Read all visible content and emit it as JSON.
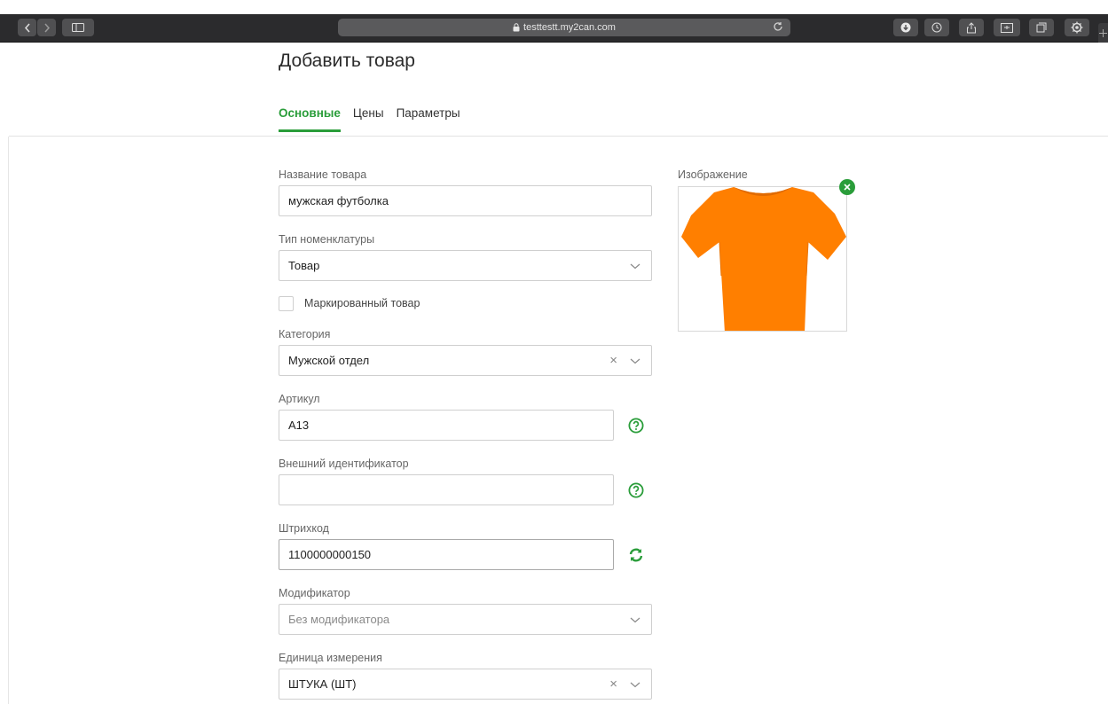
{
  "browser": {
    "url": "testtestt.my2can.com"
  },
  "page": {
    "title": "Добавить товар",
    "tabs": [
      {
        "label": "Основные",
        "active": true
      },
      {
        "label": "Цены",
        "active": false
      },
      {
        "label": "Параметры",
        "active": false
      }
    ]
  },
  "form": {
    "name": {
      "label": "Название товара",
      "value": "мужская футболка"
    },
    "type": {
      "label": "Тип номенклатуры",
      "value": "Товар"
    },
    "marked": {
      "label": "Маркированный товар",
      "checked": false
    },
    "category": {
      "label": "Категория",
      "value": "Мужской отдел"
    },
    "article": {
      "label": "Артикул",
      "value": "A13"
    },
    "external_id": {
      "label": "Внешний идентификатор",
      "value": ""
    },
    "barcode": {
      "label": "Штрихкод",
      "value": "1100000000150"
    },
    "modifier": {
      "label": "Модификатор",
      "placeholder": "Без модификатора"
    },
    "unit": {
      "label": "Единица измерения",
      "value": "ШТУКА (ШТ)"
    },
    "clear_symbol": "×"
  },
  "image": {
    "label": "Изображение",
    "product_color": "#ff7f00"
  },
  "colors": {
    "accent": "#2a9d3a",
    "toolbar": "#2b2b2d"
  }
}
